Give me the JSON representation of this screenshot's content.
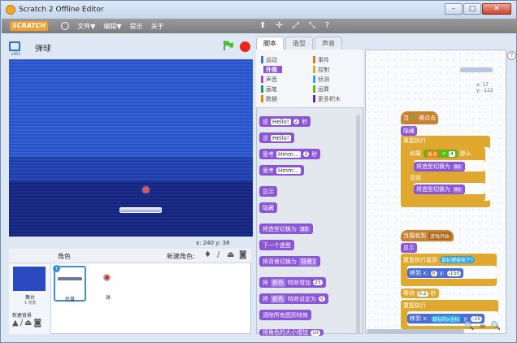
{
  "window": {
    "title": "Scratch 2 Offline Editor",
    "controls": [
      "–",
      "□",
      "✕"
    ]
  },
  "menu": {
    "logo": "SCRATCH",
    "file": "文件▼",
    "edit": "编辑▼",
    "tips": "提示",
    "about": "关于"
  },
  "tools": [
    "⬆",
    "✢",
    "⤢",
    "⤡",
    "?"
  ],
  "stage": {
    "version": "v461",
    "name": "弹球",
    "coords_label": "x: 240  y: 38"
  },
  "sprite_pane": {
    "title": "角色",
    "new_sprite": "新建角色:",
    "stage_label": "舞台",
    "stage_bg_count": "3 背景",
    "new_backdrop": "新建背景",
    "sprites": [
      {
        "name": "托盘"
      },
      {
        "name": "球"
      }
    ]
  },
  "tabs": [
    "脚本",
    "造型",
    "声音"
  ],
  "categories": [
    {
      "label": "运动",
      "color": "#4a6cd4"
    },
    {
      "label": "事件",
      "color": "#c88330"
    },
    {
      "label": "外观",
      "color": "#8a55d7"
    },
    {
      "label": "控制",
      "color": "#e0a82e"
    },
    {
      "label": "声音",
      "color": "#bb42c3"
    },
    {
      "label": "侦测",
      "color": "#2ca5e2"
    },
    {
      "label": "画笔",
      "color": "#0e9a6c"
    },
    {
      "label": "运算",
      "color": "#5cb712"
    },
    {
      "label": "数据",
      "color": "#ee7d16"
    },
    {
      "label": "更多积木",
      "color": "#632d99"
    }
  ],
  "palette_blocks": {
    "say_secs": {
      "a": "说",
      "b": "Hello!",
      "c": "2",
      "d": "秒"
    },
    "say": {
      "a": "说",
      "b": "Hello!"
    },
    "think_secs": {
      "a": "思考",
      "b": "Hmm...",
      "c": "2",
      "d": "秒"
    },
    "think": {
      "a": "思考",
      "b": "Hmm..."
    },
    "show": "显示",
    "hide": "隐藏",
    "switch_costume": {
      "a": "将造型切换为",
      "b": "80"
    },
    "next_costume": "下一个造型",
    "switch_backdrop": {
      "a": "将背景切换为",
      "b": "背景1"
    },
    "change_effect": {
      "a": "将",
      "b": "颜色",
      "c": "特效增加",
      "d": "25"
    },
    "set_effect": {
      "a": "将",
      "b": "颜色",
      "c": "特效设定为",
      "d": "0"
    },
    "clear_effects": "清除所有图形特效",
    "change_size": {
      "a": "将角色的大小增加",
      "b": "10"
    }
  },
  "script1": {
    "hat": "当",
    "hat2": "被点击",
    "hide": "隐藏",
    "forever": "重复执行",
    "if": "如果",
    "cond_a": "关卡",
    "cond_op": "<",
    "cond_b": "4",
    "then": "那么",
    "costume1": "将造型切换为",
    "costume1_val": "82",
    "else": "否则",
    "costume2": "将造型切换为",
    "costume2_val": "80"
  },
  "script2": {
    "hat": "当接收到",
    "hat_msg": "游戏开始",
    "show": "显示",
    "repeat_until": "重复执行直到",
    "until_cond": "鼠标键被按下?",
    "goto": "移到 x:",
    "goto_x": "0",
    "goto_y_label": "y:",
    "goto_y": "-150",
    "wait": "等待",
    "wait_val": "0.2",
    "wait_unit": "秒",
    "forever": "重复执行",
    "goto2": "移到 x:",
    "goto2_x": "鼠标的x坐标",
    "goto2_y_label": "y:",
    "goto2_y": "-15"
  },
  "script_area": {
    "x_readout": "x: 17",
    "y_readout": "y: -122"
  },
  "zoom": [
    "🔍",
    "=",
    "🔍"
  ]
}
